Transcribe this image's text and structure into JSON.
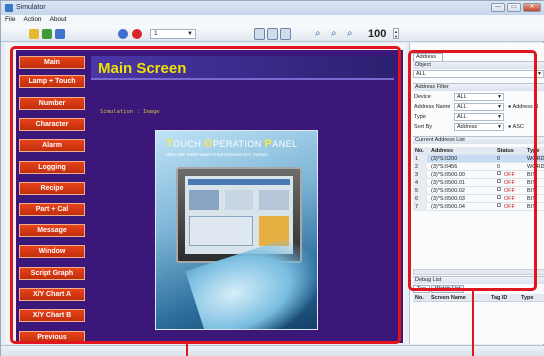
{
  "window": {
    "title": "Simulator",
    "controls": [
      "—",
      "▭",
      "✕"
    ]
  },
  "menu": [
    "File",
    "Action",
    "About"
  ],
  "toolbar": {
    "mode_selected": "1",
    "zoom": "100"
  },
  "simulator": {
    "buttons": [
      "Main",
      "Lamp + Touch",
      "Number",
      "Character",
      "Alarm",
      "Logging",
      "Recipe",
      "Part + Cal",
      "Message",
      "Window",
      "Script Graph",
      "X/Y Chart A",
      "X/Y Chart B",
      "Previous"
    ],
    "screen_title": "Main Screen",
    "caption": "Simulation : Image",
    "photo_title_parts": [
      "T",
      "OUCH ",
      "O",
      "PERATION ",
      "P",
      "ANEL"
    ],
    "photo_subtitle": "Ultra Slim Fanle Water Proof Industrial ICC System"
  },
  "address_panel": {
    "tab": "Address",
    "object_label": "Object",
    "object_value": "ALL",
    "filter_label": "Address Filter",
    "filters": [
      {
        "label": "Device",
        "value": "ALL"
      },
      {
        "label": "Address Name",
        "value": "ALL",
        "extra": "Address N"
      },
      {
        "label": "Type",
        "value": "ALL"
      },
      {
        "label": "Sort By",
        "value": "Address",
        "extra": "ASC"
      }
    ],
    "list_label": "Current Address List",
    "columns": [
      "No.",
      "Address",
      "Status",
      "Type"
    ],
    "rows": [
      {
        "no": "1",
        "address": "(3)*S:0200",
        "status": "0",
        "type": "WORD"
      },
      {
        "no": "2",
        "address": "(3)*S:0456",
        "status": "0",
        "type": "WORD"
      },
      {
        "no": "3",
        "address": "(3)*S:0500.00",
        "status": "OFF",
        "type": "BIT"
      },
      {
        "no": "4",
        "address": "(3)*S:0500.01",
        "status": "OFF",
        "type": "BIT"
      },
      {
        "no": "5",
        "address": "(3)*S:0500.02",
        "status": "OFF",
        "type": "BIT"
      },
      {
        "no": "6",
        "address": "(3)*S:0500.03",
        "status": "OFF",
        "type": "BIT"
      },
      {
        "no": "7",
        "address": "(3)*S:0500.04",
        "status": "OFF",
        "type": "BIT"
      }
    ],
    "debug_label": "Debug List",
    "debug_tabs": [
      "Tag",
      "Watch List"
    ],
    "debug_columns": [
      "No.",
      "Screen Name",
      "Tag ID",
      "Type"
    ]
  },
  "colors": {
    "callout": "#e0151e",
    "screen_bg": "#3a1778",
    "button": "#d53a14",
    "title_yellow": "#f0e200"
  }
}
